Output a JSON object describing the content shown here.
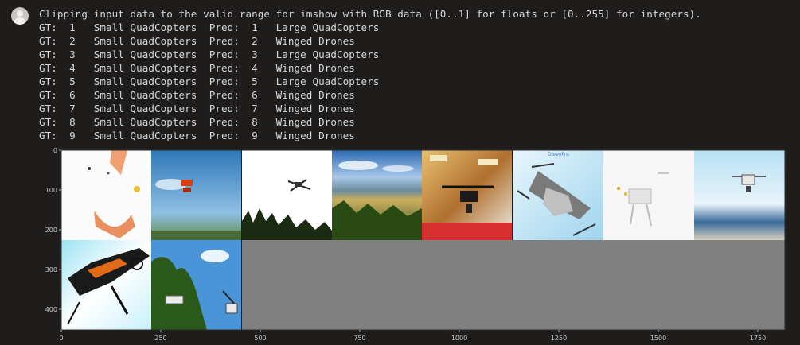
{
  "cell": {
    "avatar_icon": "user-avatar-icon",
    "warning_line": "Clipping input data to the valid range for imshow with RGB data ([0..1] for floats or [0..255] for integers).",
    "predictions": [
      {
        "gt": "1",
        "gt_label": "Small QuadCopters",
        "pred": "1",
        "pred_label": "Large QuadCopters"
      },
      {
        "gt": "2",
        "gt_label": "Small QuadCopters",
        "pred": "2",
        "pred_label": "Winged Drones"
      },
      {
        "gt": "3",
        "gt_label": "Small QuadCopters",
        "pred": "3",
        "pred_label": "Large QuadCopters"
      },
      {
        "gt": "4",
        "gt_label": "Small QuadCopters",
        "pred": "4",
        "pred_label": "Winged Drones"
      },
      {
        "gt": "5",
        "gt_label": "Small QuadCopters",
        "pred": "5",
        "pred_label": "Large QuadCopters"
      },
      {
        "gt": "6",
        "gt_label": "Small QuadCopters",
        "pred": "6",
        "pred_label": "Winged Drones"
      },
      {
        "gt": "7",
        "gt_label": "Small QuadCopters",
        "pred": "7",
        "pred_label": "Winged Drones"
      },
      {
        "gt": "8",
        "gt_label": "Small QuadCopters",
        "pred": "8",
        "pred_label": "Winged Drones"
      },
      {
        "gt": "9",
        "gt_label": "Small QuadCopters",
        "pred": "9",
        "pred_label": "Winged Drones"
      }
    ]
  },
  "figure": {
    "x_ticks": [
      "0",
      "250",
      "500",
      "750",
      "1000",
      "1250",
      "1500",
      "1750"
    ],
    "y_ticks": [
      "0",
      "100",
      "200",
      "300",
      "400"
    ],
    "image_text": "DjeeoPro",
    "grid_background_color": "#808080",
    "tiles": [
      {
        "name": "tile-1-orange-blur"
      },
      {
        "name": "tile-2-sky-red-drone"
      },
      {
        "name": "tile-3-black-drone-trees"
      },
      {
        "name": "tile-4-landscape"
      },
      {
        "name": "tile-5-wood-drone"
      },
      {
        "name": "tile-6-grey-drone-closeup"
      },
      {
        "name": "tile-7-white-drone"
      },
      {
        "name": "tile-8-beach-drone"
      },
      {
        "name": "tile-9-orange-drone"
      },
      {
        "name": "tile-10-drone-trees"
      }
    ]
  }
}
